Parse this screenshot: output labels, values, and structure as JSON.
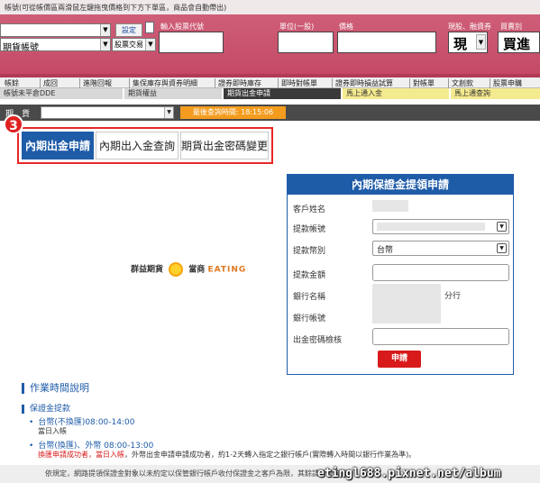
{
  "top_hint": "帳號(可從帳價區兩滑鼠左鍵拖曳價格到下方下單區，商品會自動帶出)",
  "order_panel": {
    "account_select_value": "期貨帳號",
    "setting_button": "設定",
    "order_type_select": "股票交易",
    "stock_code_label": "輸入股票代號",
    "unit_label": "單位(一股)",
    "price_label": "價格",
    "cash_margin_label": "現股、融資券",
    "buy_sell_label": "買賣別",
    "cash_value": "現",
    "buy_value": "買進"
  },
  "tabs_row1": [
    "帳餘",
    "成回",
    "進階回報",
    "集保庫存與資券明細",
    "證券即時庫存",
    "即時對帳單",
    "證券即時損益試算",
    "對帳單",
    "文創款",
    "股票申購"
  ],
  "tabs_row2": [
    "帳號未平倉DDE",
    "期貨權益",
    "期貨出金申請",
    "馬上通入金",
    "馬上通查詢"
  ],
  "account_row": {
    "label": "期　貨",
    "query_time": "最後查詢時間: 18:15:06"
  },
  "badge": "3",
  "subtabs": [
    "內期出金申請",
    "內期出入金查詢",
    "期貨出金密碼變更"
  ],
  "logo": {
    "left_text": "群益期貨",
    "right_text": "當商",
    "eat_text": "EATING"
  },
  "form": {
    "title": "內期保證金提領申請",
    "customer_name_label": "客戶姓名",
    "withdraw_account_label": "提款帳號",
    "withdraw_currency_label": "提款幣別",
    "currency_value": "台幣",
    "withdraw_amount_label": "提款金額",
    "bank_name_label": "銀行名稱",
    "branch_suffix": "分行",
    "bank_account_label": "銀行帳號",
    "password_check_label": "出金密碼檢核",
    "submit_label": "申請"
  },
  "info": {
    "section_title": "作業時間說明",
    "sub_title": "保證金提款",
    "item1_title": "台幣(不換匯)08:00-14:00",
    "item1_detail": "當日入帳",
    "item2_title": "台幣(換匯)、外幣 08:00-13:00",
    "item2_detail_red": "換匯申請成功者，當日入帳",
    "item2_detail_rest": "，外幣出金申請申請成功者，約1-2天轉入指定之銀行帳戶(實際轉入時間以銀行作業為準)。",
    "footnote": "依規定，網路提領保證金對象以未約定以保管銀行帳戶收付保證金之客戶為限，其餘請洽營業員"
  },
  "watermark": "etingl688.pixnet.net/album"
}
